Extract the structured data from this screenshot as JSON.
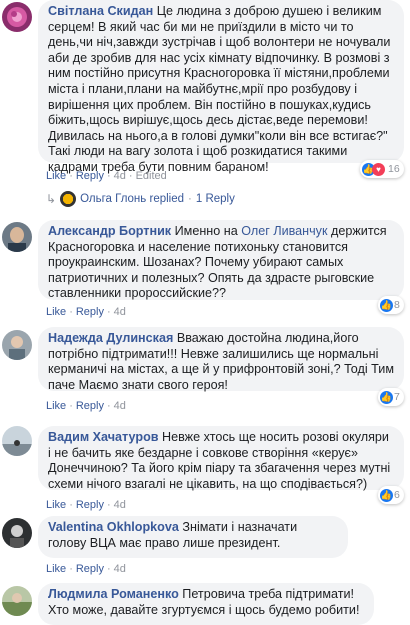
{
  "colors": {
    "link": "#385898",
    "bubble": "#f2f3f5",
    "meta": "#90949c",
    "like": "#1877f2",
    "love": "#f33e58"
  },
  "actions": {
    "like": "Like",
    "reply": "Reply",
    "separator": "·"
  },
  "comments": [
    {
      "author": "Світлана Скидан",
      "text": "Це людина з доброю душею і великим серцем! В який час би ми не приїздили в місто чи то день,чи ніч,завжди зустрічав і щоб волонтери не ночували аби де зробив для нас усіх кімнату відпочинку. В розмові з ним постійно присутня Красногоровка її містяни,проблеми міста і плани,плани на майбутнє,мрії про розбудову і вирішення цих проблем. Він постійно в пошуках,кудись біжить,щось вирішує,щось десь дістає,веде перемови! Дивилась на нього,а в голові думки\"коли він все встигає?\" Такі люди на вагу золота і щоб розкидатися такими кадрами треба бути повним бараном!",
      "time": "4d",
      "edited": "Edited",
      "reactions": {
        "count": "16",
        "types": [
          "like-icon",
          "love-icon"
        ]
      },
      "replied": {
        "name": "Ольга Глонь",
        "label": "replied",
        "count": "1 Reply"
      }
    },
    {
      "author": "Александр Бортник",
      "text_before": "Именно на",
      "mention": "Олег Ливанчук",
      "text_after": "держится Красногоровка и население потихоньку становится проукраинским. Шозанах? Почему убирают самых патриотичних и полезных? Опять да здрасте рыговские ставленники пророссийские??",
      "time": "4d",
      "reactions": {
        "count": "8",
        "types": [
          "like-icon"
        ]
      }
    },
    {
      "author": "Надежда Дулинская",
      "text": "Вважаю достойна людина,його потрібно підтримати!!! Невже залишились ще нормальні керманичі на містах, а ще й у прифронтовій зоні,? Тоді Тим паче Маємо знати свого героя!",
      "time": "4d",
      "reactions": {
        "count": "7",
        "types": [
          "like-icon"
        ]
      }
    },
    {
      "author": "Вадим Хачатуров",
      "text": "Невже хтось ще носить розові окуляри і не бачить яке бездарне і совкове створіння «керує» Донеччиною? Та його крім піару та збагачення через мутні схеми нічого взагалі не цікавить, на що сподівається?)",
      "time": "4d",
      "reactions": {
        "count": "6",
        "types": [
          "like-icon"
        ]
      }
    },
    {
      "author": "Valentina Okhlopkova",
      "text": "Знімати і назначати голову ВЦА має право лише президент.",
      "time": "4d"
    },
    {
      "author": "Людмила Романенко",
      "text": "Петровича треба підтримати! Хто може, давайте згуртуємся і щось будемо робити!"
    }
  ]
}
